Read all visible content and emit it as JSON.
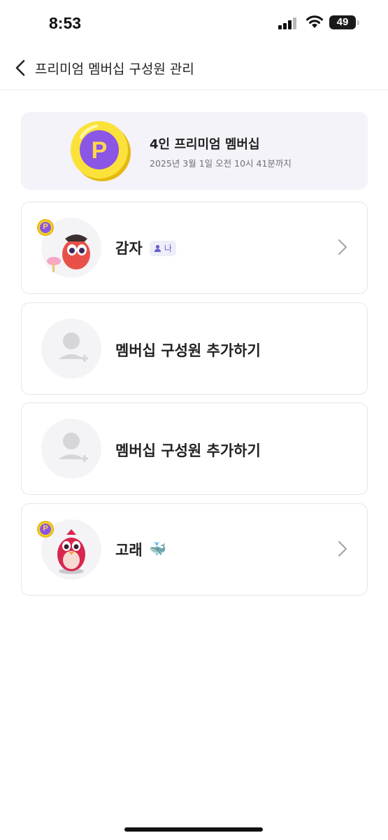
{
  "status": {
    "time": "8:53",
    "battery": "49"
  },
  "nav": {
    "title": "프리미엄 멤버십 구성원 관리"
  },
  "plan": {
    "title": "4인 프리미엄 멤버십",
    "expiry": "2025년 3월 1일 오전 10시 41분까지",
    "coin_letter": "P"
  },
  "members": [
    {
      "type": "member",
      "name": "감자",
      "tag": "나",
      "badge": "P"
    },
    {
      "type": "add",
      "label": "멤버십 구성원 추가하기"
    },
    {
      "type": "add",
      "label": "멤버십 구성원 추가하기"
    },
    {
      "type": "member",
      "name": "고래",
      "emoji": "🐳",
      "badge": "P"
    }
  ],
  "colors": {
    "accent": "#8b55e6",
    "coin": "#f5d424",
    "card_bg": "#f3f3f9"
  }
}
